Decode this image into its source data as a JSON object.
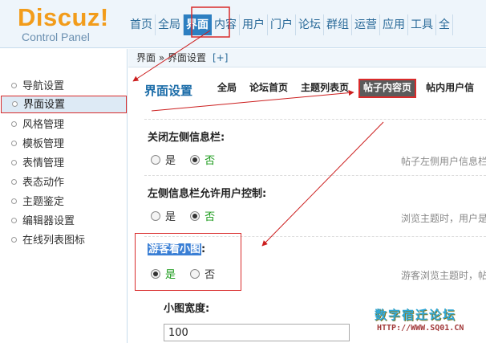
{
  "logo": {
    "main": "Discuz!",
    "sub": "Control Panel"
  },
  "topnav": {
    "items": [
      {
        "label": "首页",
        "active": false
      },
      {
        "label": "全局",
        "active": false
      },
      {
        "label": "界面",
        "active": true
      },
      {
        "label": "内容",
        "active": false
      },
      {
        "label": "用户",
        "active": false
      },
      {
        "label": "门户",
        "active": false
      },
      {
        "label": "论坛",
        "active": false
      },
      {
        "label": "群组",
        "active": false
      },
      {
        "label": "运营",
        "active": false
      },
      {
        "label": "应用",
        "active": false
      },
      {
        "label": "工具",
        "active": false
      },
      {
        "label": "全",
        "active": false
      }
    ]
  },
  "breadcrumb": {
    "text": "界面 » 界面设置",
    "plus": "[+]"
  },
  "sidebar": {
    "items": [
      {
        "label": "导航设置",
        "active": false
      },
      {
        "label": "界面设置",
        "active": true
      },
      {
        "label": "风格管理",
        "active": false
      },
      {
        "label": "模板管理",
        "active": false
      },
      {
        "label": "表情管理",
        "active": false
      },
      {
        "label": "表态动作",
        "active": false
      },
      {
        "label": "主题鉴定",
        "active": false
      },
      {
        "label": "编辑器设置",
        "active": false
      },
      {
        "label": "在线列表图标",
        "active": false
      }
    ]
  },
  "main": {
    "title": "界面设置",
    "subtabs": [
      {
        "label": "全局",
        "active": false
      },
      {
        "label": "论坛首页",
        "active": false
      },
      {
        "label": "主题列表页",
        "active": false
      },
      {
        "label": "帖子内容页",
        "active": true
      },
      {
        "label": "帖内用户信",
        "active": false
      }
    ],
    "settings": [
      {
        "label": "关闭左侧信息栏:",
        "options": [
          {
            "label": "是",
            "checked": false
          },
          {
            "label": "否",
            "checked": true
          }
        ],
        "help": "帖子左侧用户信息栏"
      },
      {
        "label": "左侧信息栏允许用户控制:",
        "options": [
          {
            "label": "是",
            "checked": false
          },
          {
            "label": "否",
            "checked": true
          }
        ],
        "help": "浏览主题时，用户是"
      },
      {
        "label_highlight": "游客看小图",
        "label_suffix": ":",
        "options": [
          {
            "label": "是",
            "checked": true
          },
          {
            "label": "否",
            "checked": false
          }
        ],
        "help": "游客浏览主题时，帖"
      }
    ],
    "width_field": {
      "label": "小图宽度:",
      "value": "100"
    }
  },
  "watermark": {
    "cn": "数字宿迁论坛",
    "url": "HTTP://WWW.SQ01.CN"
  },
  "colors": {
    "accent": "#2d7fc1",
    "highlight_border": "#d92b2b",
    "logo_orange": "#f29c1b",
    "checked_green": "#1a9a1a"
  }
}
